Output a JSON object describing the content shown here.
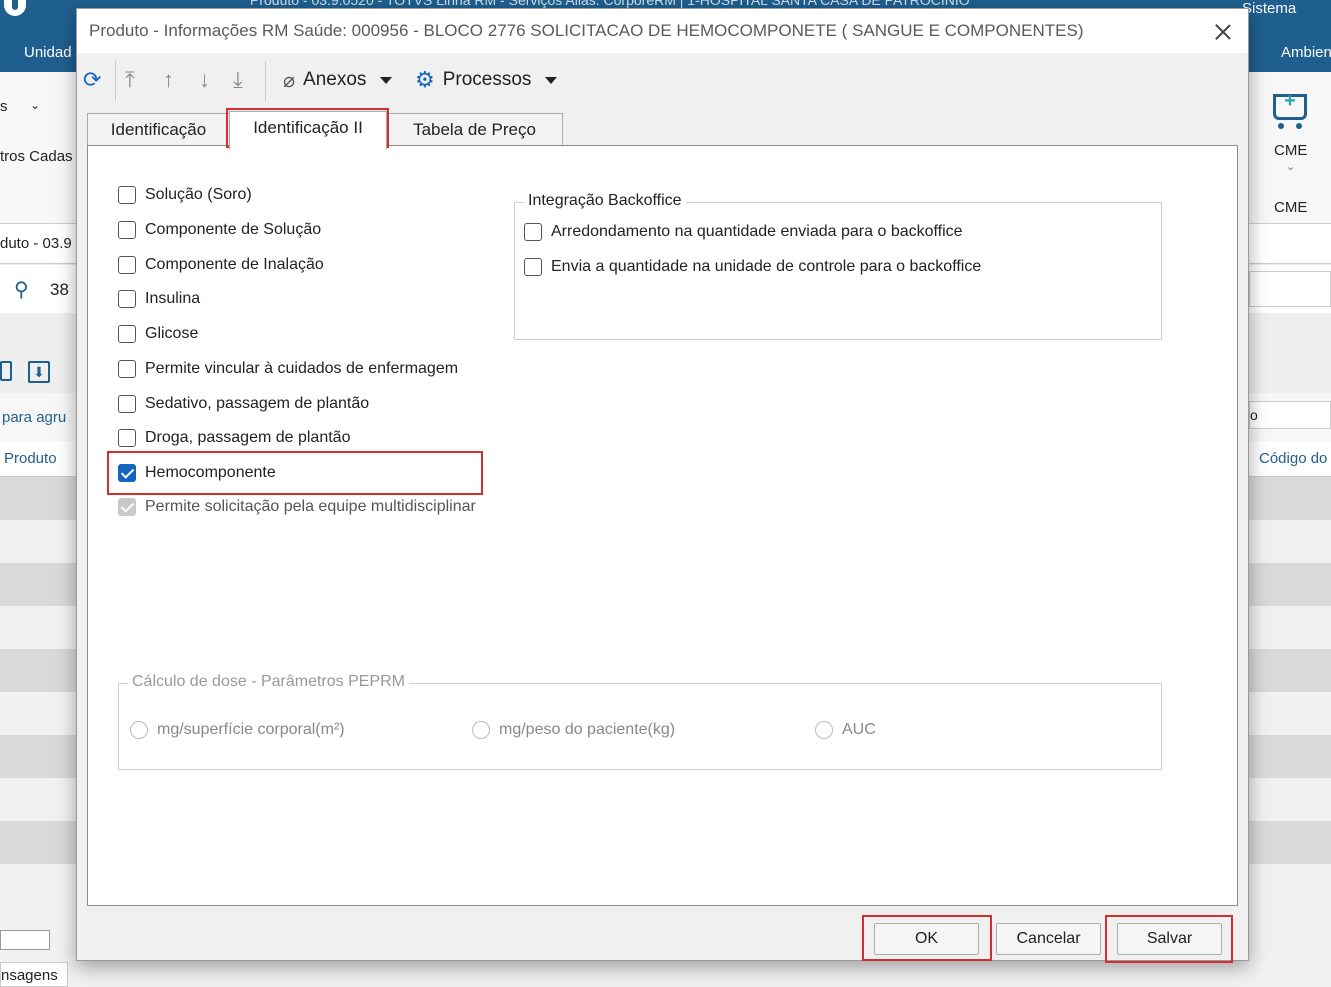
{
  "background": {
    "header_partial_title": "Produto - 03.9.0520 - TOTVS Linha RM - Serviços Alias: CorporeRM | 1-HOSPITAL SANTA CASA DE PATROCINIO",
    "menu_left": "Unidad",
    "menu_sistema": "Sistema",
    "menu_ambiente": "Ambien",
    "ribbon_left_1": "s",
    "ribbon_left_2": "tros Cadas",
    "ribbon_cme_top": "CME",
    "ribbon_cme_bottom": "CME",
    "window_title_partial": "duto - 03.9",
    "search_value": "38",
    "group_hint": "para agru",
    "col_produto": "Produto",
    "col_codigo": "Código do",
    "right_field_char": "o",
    "footer_tab": "nsagens"
  },
  "dialog": {
    "title": "Produto - Informações RM Saúde: 000956 - BLOCO 2776  SOLICITACAO DE HEMOCOMPONETE ( SANGUE E COMPONENTES)",
    "toolbar": {
      "anexos_label": "Anexos",
      "processos_label": "Processos"
    },
    "tabs": [
      {
        "label": "Identificação"
      },
      {
        "label": "Identificação II"
      },
      {
        "label": "Tabela de Preço"
      }
    ],
    "active_tab": "Identificação II",
    "checkboxes": [
      {
        "label": "Solução (Soro)",
        "checked": false
      },
      {
        "label": "Componente de Solução",
        "checked": false
      },
      {
        "label": "Componente de Inalação",
        "checked": false
      },
      {
        "label": "Insulina",
        "checked": false
      },
      {
        "label": "Glicose",
        "checked": false
      },
      {
        "label": "Permite vincular à cuidados de enfermagem",
        "checked": false
      },
      {
        "label": "Sedativo, passagem de plantão",
        "checked": false
      },
      {
        "label": "Droga, passagem de plantão",
        "checked": false
      },
      {
        "label": "Hemocomponente",
        "checked": true
      },
      {
        "label": "Permite solicitação pela equipe multidisciplinar",
        "checked": true,
        "disabled": true
      }
    ],
    "backoffice": {
      "title": "Integração Backoffice",
      "options": [
        {
          "label": "Arredondamento na quantidade enviada para o backoffice",
          "checked": false
        },
        {
          "label": "Envia a quantidade na unidade de controle para o backoffice",
          "checked": false
        }
      ]
    },
    "dose": {
      "title": "Cálculo de dose - Parâmetros PEPRM",
      "options": [
        {
          "label": "mg/superfície corporal(m²)",
          "selected": false
        },
        {
          "label": "mg/peso do paciente(kg)",
          "selected": false
        },
        {
          "label": "AUC",
          "selected": false
        }
      ]
    },
    "buttons": {
      "ok": "OK",
      "cancel": "Cancelar",
      "save": "Salvar"
    },
    "highlight_color": "#d32f2f",
    "accent_color": "#1565c0"
  }
}
